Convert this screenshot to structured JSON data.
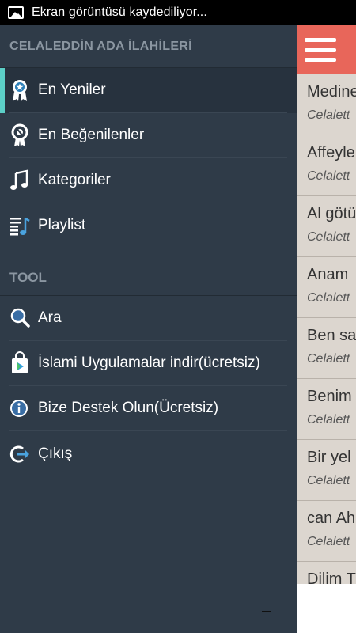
{
  "status_bar": {
    "text": "Ekran görüntüsü kaydediliyor...",
    "icon": "image-icon"
  },
  "drawer": {
    "header": "CELALEDDİN ADA İLAHİLERİ",
    "items": [
      {
        "label": "En Yeniler",
        "icon": "award-ribbon-icon",
        "active": true
      },
      {
        "label": "En Beğenilenler",
        "icon": "medal-icon"
      },
      {
        "label": "Kategoriler",
        "icon": "music-note-icon"
      },
      {
        "label": "Playlist",
        "icon": "playlist-icon"
      }
    ],
    "tool_section": "TOOL",
    "tool_items": [
      {
        "label": "Ara",
        "icon": "search-icon"
      },
      {
        "label": "İslami Uygulamalar indir(ücretsiz)",
        "icon": "play-store-bag-icon"
      },
      {
        "label": "Bize Destek Olun(Ücretsiz)",
        "icon": "info-icon"
      },
      {
        "label": "Çıkış",
        "icon": "exit-icon"
      }
    ],
    "accent_color": "#5ccfc7"
  },
  "content": {
    "appbar_color": "#e8665a",
    "menu_icon": "hamburger-menu-icon",
    "list": [
      {
        "title": "Medine",
        "subtitle": "Celalett"
      },
      {
        "title": "Affeyle",
        "subtitle": "Celalett"
      },
      {
        "title": "Al götü",
        "subtitle": "Celalett"
      },
      {
        "title": "Anam",
        "subtitle": "Celalett"
      },
      {
        "title": "Ben sa",
        "subtitle": "Celalett"
      },
      {
        "title": "Benim",
        "subtitle": "Celalett"
      },
      {
        "title": "Bir yel",
        "subtitle": "Celalett"
      },
      {
        "title": "can Ah",
        "subtitle": "Celalett"
      },
      {
        "title": "Dilim T",
        "subtitle": ""
      }
    ]
  }
}
